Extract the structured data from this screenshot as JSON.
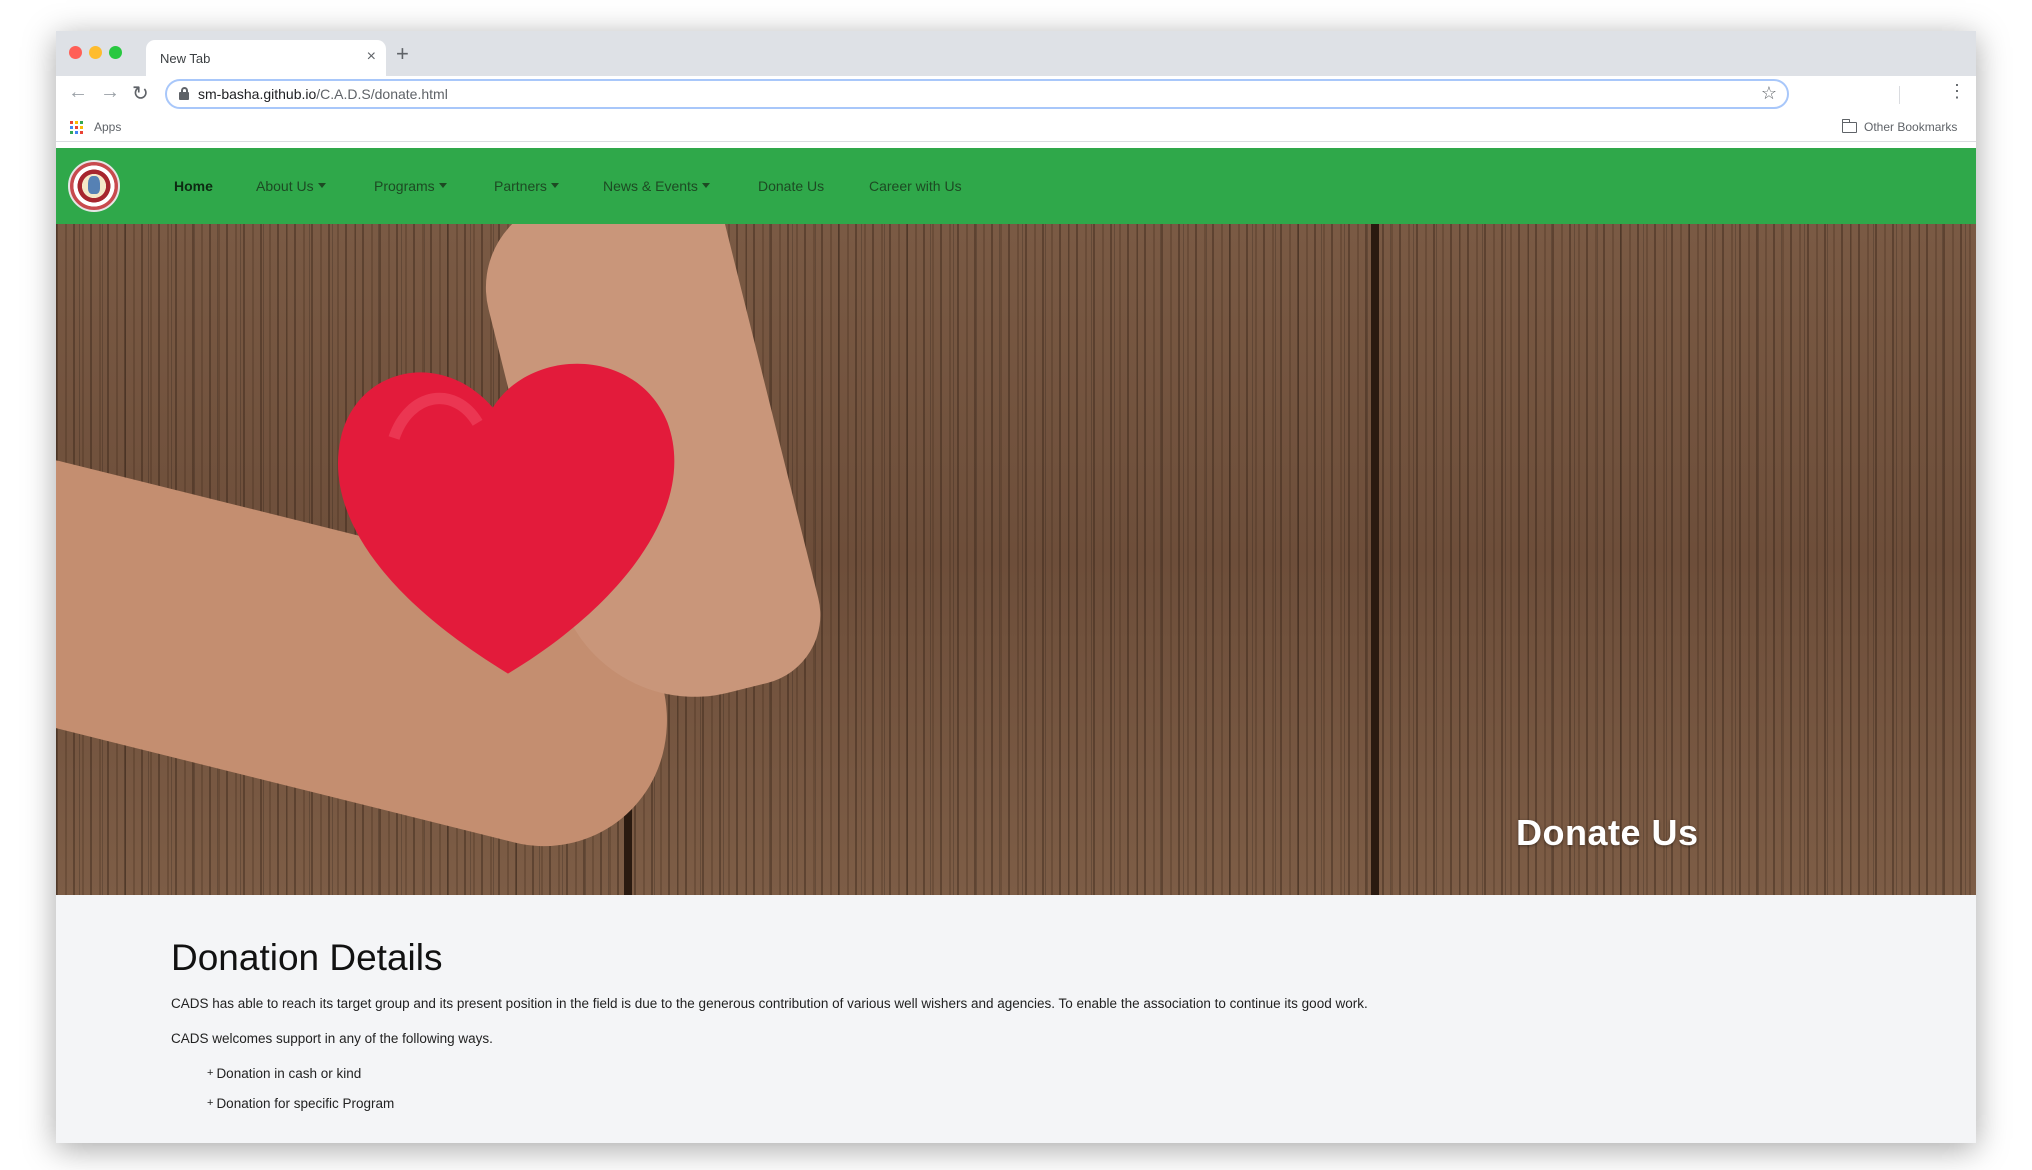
{
  "browser": {
    "tab_title": "New Tab",
    "tab_close": "×",
    "new_tab": "+",
    "back": "←",
    "forward": "→",
    "reload": "↻",
    "url_host": "sm-basha.github.io",
    "url_path": "/C.A.D.S/donate.html",
    "star": "☆",
    "menu": "⋮",
    "bookmarks": {
      "apps_label": "Apps",
      "other_label": "Other Bookmarks"
    }
  },
  "site": {
    "nav": {
      "items": [
        {
          "label": "Home"
        },
        {
          "label": "About Us"
        },
        {
          "label": "Programs"
        },
        {
          "label": "Partners"
        },
        {
          "label": "News & Events"
        },
        {
          "label": "Donate Us"
        },
        {
          "label": "Career with Us"
        }
      ],
      "brand_color": "#2fa84a"
    },
    "hero": {
      "title": "Donate Us"
    },
    "content": {
      "heading": "Donation Details",
      "para1": "CADS has able to reach its target group and its present position in the field is due to the generous contribution of various well wishers and agencies. To enable the association to continue its good work.",
      "para2": "CADS welcomes support in any of the following ways.",
      "list": [
        "Donation in cash or kind",
        "Donation for specific Program"
      ],
      "bullet": "+"
    }
  }
}
